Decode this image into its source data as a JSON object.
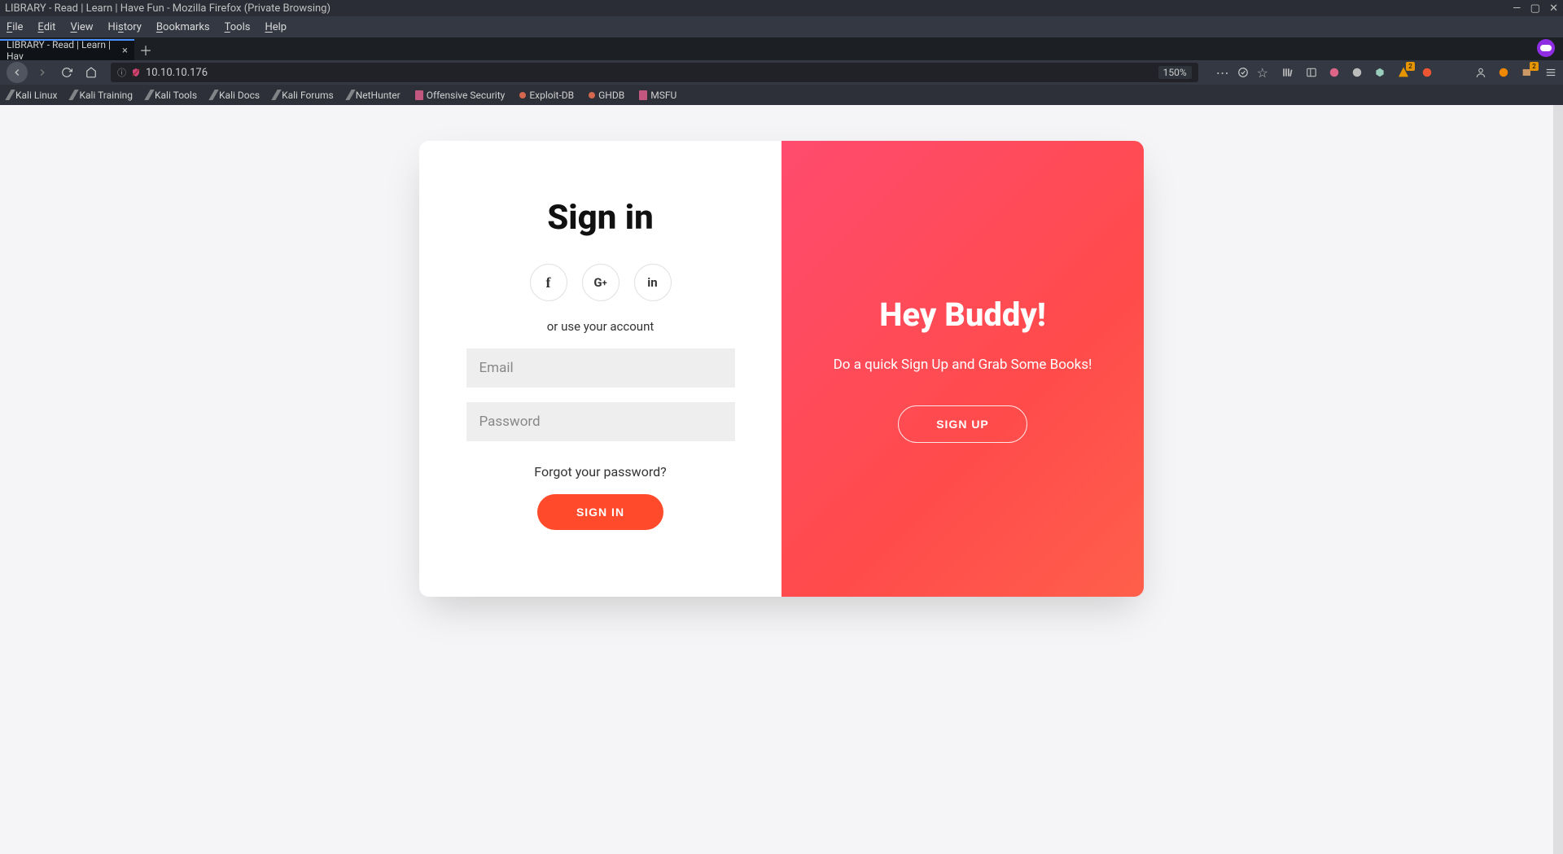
{
  "window": {
    "title": "LIBRARY - Read | Learn | Have Fun - Mozilla Firefox (Private Browsing)"
  },
  "menubar": [
    "File",
    "Edit",
    "View",
    "History",
    "Bookmarks",
    "Tools",
    "Help"
  ],
  "tab": {
    "title": "LIBRARY - Read | Learn | Hav"
  },
  "url": {
    "address": "10.10.10.176",
    "zoom": "150%"
  },
  "bookmarks": [
    "Kali Linux",
    "Kali Training",
    "Kali Tools",
    "Kali Docs",
    "Kali Forums",
    "NetHunter",
    "Offensive Security",
    "Exploit-DB",
    "GHDB",
    "MSFU"
  ],
  "signin": {
    "heading": "Sign in",
    "subtext": "or use your account",
    "email_placeholder": "Email",
    "password_placeholder": "Password",
    "forgot": "Forgot your password?",
    "button": "SIGN IN"
  },
  "signup": {
    "heading": "Hey Buddy!",
    "text": "Do a quick Sign Up and Grab Some Books!",
    "button": "SIGN UP"
  }
}
